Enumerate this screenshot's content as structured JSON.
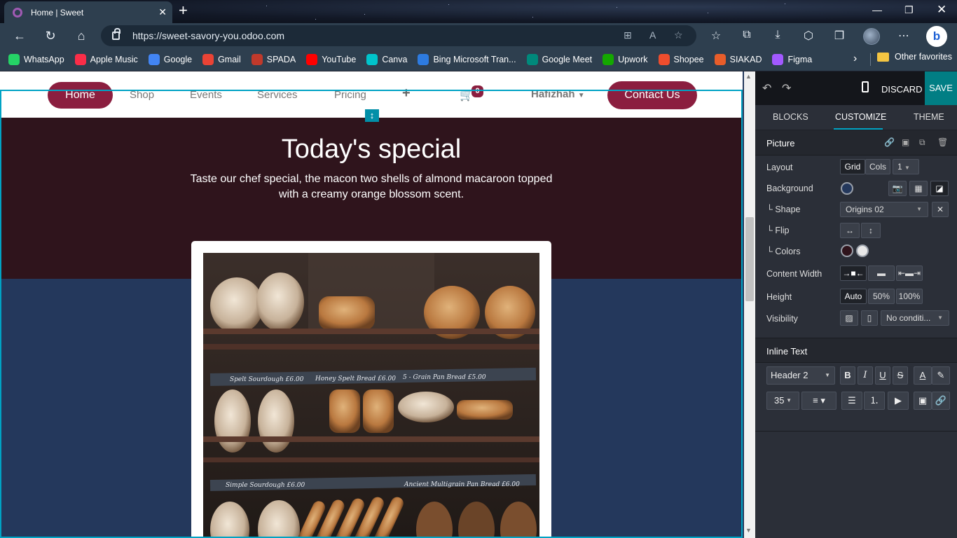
{
  "browser": {
    "tab_title": "Home | Sweet",
    "url": "https://sweet-savory-you.odoo.com",
    "bookmarks": [
      {
        "label": "WhatsApp",
        "color": "#25d366"
      },
      {
        "label": "Apple Music",
        "color": "#fa2d48"
      },
      {
        "label": "Google",
        "color": "#4285f4"
      },
      {
        "label": "Gmail",
        "color": "#ea4335"
      },
      {
        "label": "SPADA",
        "color": "#c0392b"
      },
      {
        "label": "YouTube",
        "color": "#ff0000"
      },
      {
        "label": "Canva",
        "color": "#00c4cc"
      },
      {
        "label": "Bing Microsoft Tran...",
        "color": "#2d7be0"
      },
      {
        "label": "Google Meet",
        "color": "#00897b"
      },
      {
        "label": "Upwork",
        "color": "#14a800"
      },
      {
        "label": "Shopee",
        "color": "#ee4d2d"
      },
      {
        "label": "SIAKAD",
        "color": "#e85d2a"
      },
      {
        "label": "Figma",
        "color": "#a259ff"
      }
    ],
    "other_favorites": "Other favorites"
  },
  "site": {
    "nav": {
      "home": "Home",
      "shop": "Shop",
      "events": "Events",
      "services": "Services",
      "pricing": "Pricing",
      "cart_count": "0",
      "user": "Hafizhah",
      "contact": "Contact Us"
    },
    "hero": {
      "title": "Today's special",
      "subtitle": "Taste our chef special, the macon two shells of almond macaroon topped with a creamy orange blossom scent."
    },
    "photo_labels": [
      "Spelt Sourdough £6.00",
      "Honey Spelt Bread £6.00",
      "5 - Grain Pan Bread £5.00",
      "Simple Sourdough £6.00",
      "Ancient Multigrain Pan Bread £6.00"
    ]
  },
  "editor": {
    "discard": "DISCARD",
    "save": "SAVE",
    "tabs": {
      "blocks": "BLOCKS",
      "customize": "CUSTOMIZE",
      "theme": "THEME"
    },
    "picture": {
      "title": "Picture",
      "layout_label": "Layout",
      "grid": "Grid",
      "cols": "Cols",
      "cols_value": "1",
      "background_label": "Background",
      "background_color": "#24385c",
      "shape_label": "└ Shape",
      "shape_value": "Origins 02",
      "flip_label": "└ Flip",
      "colors_label": "└ Colors",
      "content_width_label": "Content Width",
      "height_label": "Height",
      "height_auto": "Auto",
      "height_50": "50%",
      "height_100": "100%",
      "visibility_label": "Visibility",
      "visibility_value": "No conditi..."
    },
    "inline_text": {
      "title": "Inline Text",
      "style_value": "Header 2",
      "font_size": "35"
    }
  },
  "colors": {
    "brand": "#8b1e3f",
    "hero_bg": "#2f141c",
    "section_bg": "#24385c",
    "odoo_teal": "#017e84",
    "selection": "#00a3c4"
  }
}
